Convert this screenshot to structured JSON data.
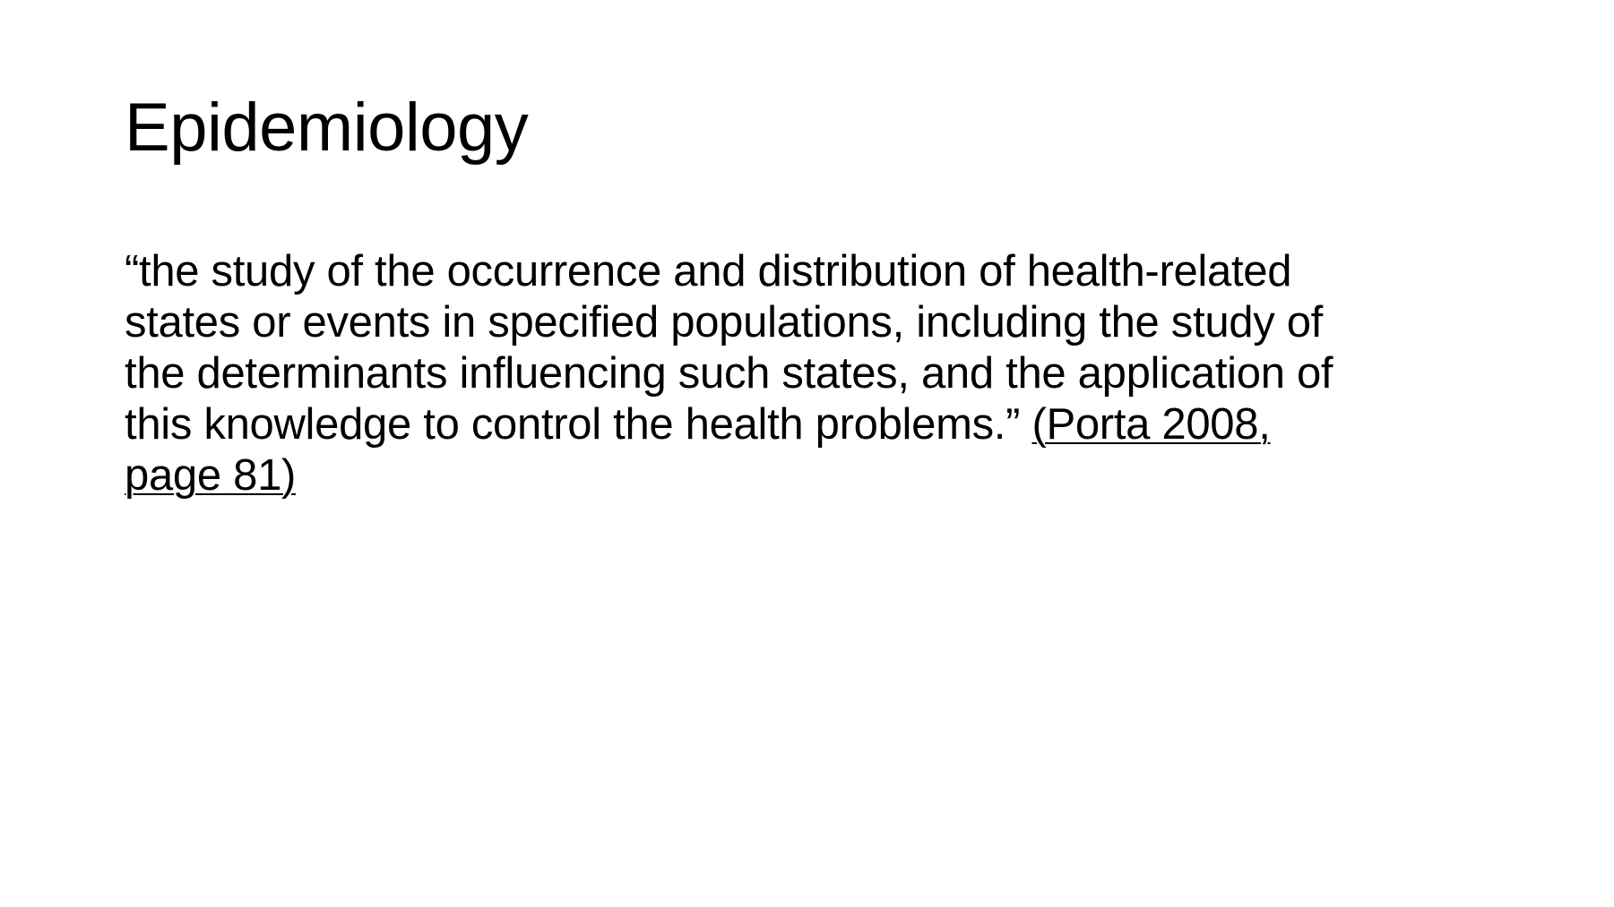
{
  "slide": {
    "title": "Epidemiology",
    "quote_lines": [
      "“the study of the occurrence and distribution of health-related",
      "states or events in specified populations, including the study of",
      "the determinants influencing such states, and the application of",
      "this knowledge to control the health problems.” "
    ],
    "citation": {
      "line1": "(Porta 2008,",
      "line2": "page 81)"
    }
  }
}
